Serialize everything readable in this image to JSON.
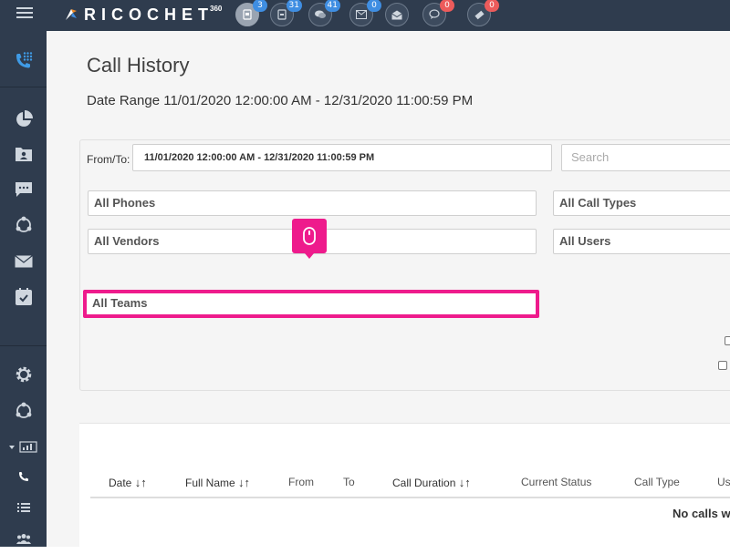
{
  "topbar": {
    "logo_text": "RICOCHET",
    "logo_sup": "360",
    "icons": [
      {
        "name": "calls-icon",
        "badge": "3",
        "badge_color": "blue"
      },
      {
        "name": "voicemail-icon",
        "badge": "31",
        "badge_color": "blue"
      },
      {
        "name": "chat-icon",
        "badge": "41",
        "badge_color": "blue"
      },
      {
        "name": "email-icon",
        "badge": "0",
        "badge_color": "blue"
      },
      {
        "name": "open-mail-icon",
        "badge": "",
        "badge_color": ""
      },
      {
        "name": "message-icon",
        "badge": "0",
        "badge_color": "red"
      },
      {
        "name": "ticket-icon",
        "badge": "0",
        "badge_color": "red"
      }
    ]
  },
  "page": {
    "title": "Call History",
    "date_range": "Date Range 11/01/2020 12:00:00 AM - 12/31/2020 11:00:59 PM"
  },
  "filters": {
    "from_to_label": "From/To:",
    "date_range_value": "11/01/2020 12:00:00 AM - 12/31/2020 11:00:59 PM",
    "search_placeholder": "Search",
    "phones": "All Phones",
    "call_types": "All Call Types",
    "vendors": "All Vendors",
    "users": "All Users",
    "teams": "All Teams"
  },
  "table": {
    "columns": [
      "Date",
      "Full Name",
      "From",
      "To",
      "Call Duration",
      "Current Status",
      "Call Type",
      "Us"
    ],
    "empty_message": "No calls w"
  },
  "colors": {
    "sidebar": "#2f3c4e",
    "highlight": "#ee1b8c",
    "badge_blue": "#3f8ee2",
    "badge_red": "#ec5b5b"
  }
}
